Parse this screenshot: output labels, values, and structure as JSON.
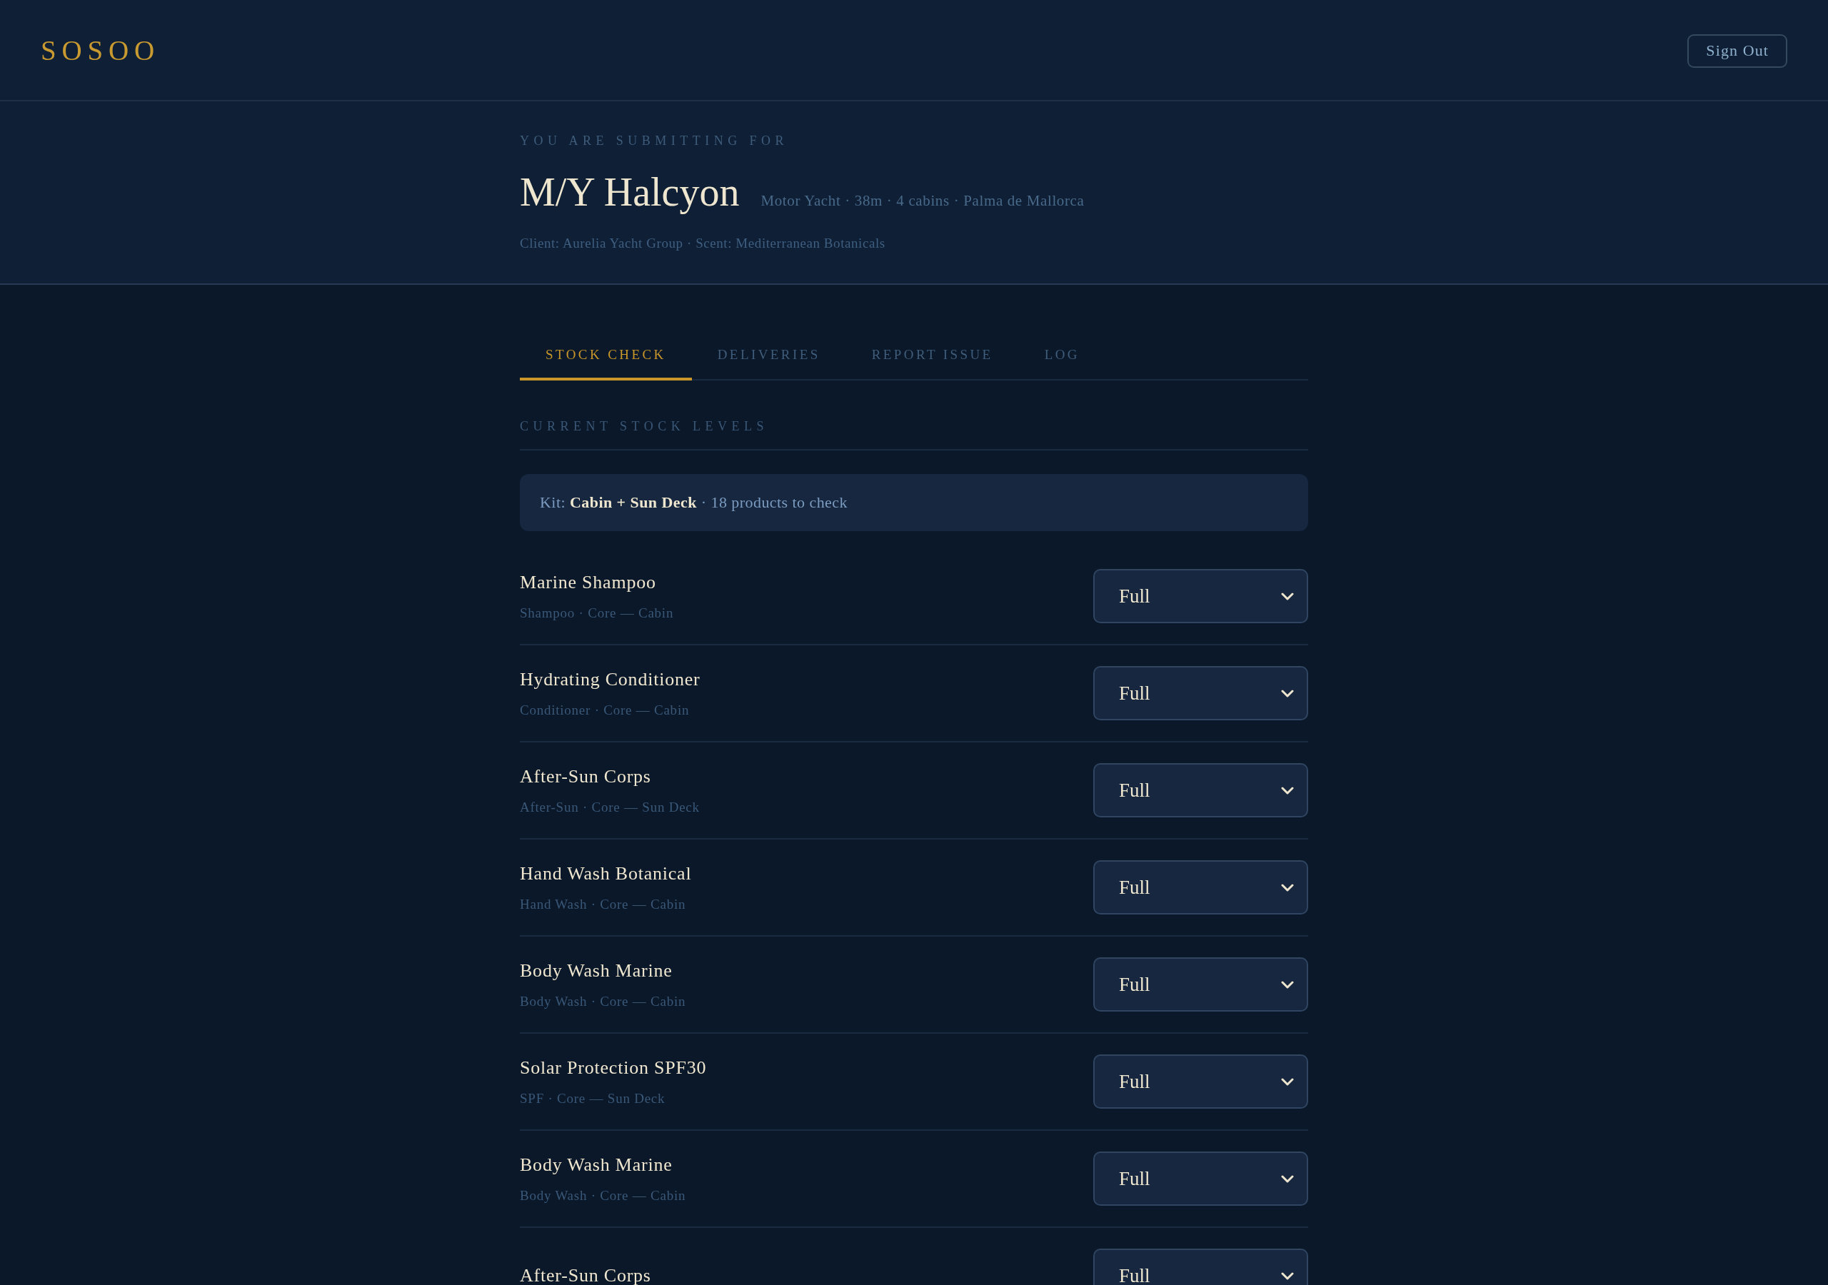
{
  "header": {
    "logo": "SOSOO",
    "sign_out": "Sign Out"
  },
  "vessel": {
    "eyebrow": "YOU ARE SUBMITTING FOR",
    "name": "M/Y Halcyon",
    "details": "Motor Yacht · 38m · 4 cabins · Palma de Mallorca",
    "client_line": "Client: Aurelia Yacht Group · Scent: Mediterranean Botanicals"
  },
  "tabs": [
    {
      "label": "STOCK CHECK",
      "selected": true
    },
    {
      "label": "DELIVERIES",
      "selected": false
    },
    {
      "label": "REPORT ISSUE",
      "selected": false
    },
    {
      "label": "LOG",
      "selected": false
    }
  ],
  "section_title": "CURRENT STOCK LEVELS",
  "kit_summary": "Kit: **Cabin + Sun Deck** · 18 products to check",
  "products": [
    {
      "name": "Marine Shampoo",
      "details": "Shampoo · Core — Cabin",
      "status": "Full"
    },
    {
      "name": "Hydrating Conditioner",
      "details": "Conditioner · Core — Cabin",
      "status": "Full"
    },
    {
      "name": "After-Sun Corps",
      "details": "After-Sun · Core — Sun Deck",
      "status": "Full"
    },
    {
      "name": "Hand Wash Botanical",
      "details": "Hand Wash · Core — Cabin",
      "status": "Full"
    },
    {
      "name": "Body Wash Marine",
      "details": "Body Wash · Core — Cabin",
      "status": "Full"
    },
    {
      "name": "Solar Protection SPF30",
      "details": "SPF · Core — Sun Deck",
      "status": "Full"
    },
    {
      "name": "Body Wash Marine",
      "details": "Body Wash · Core — Cabin",
      "status": "Full"
    },
    {
      "name": "After-Sun Corps",
      "status": "Full"
    }
  ]
}
